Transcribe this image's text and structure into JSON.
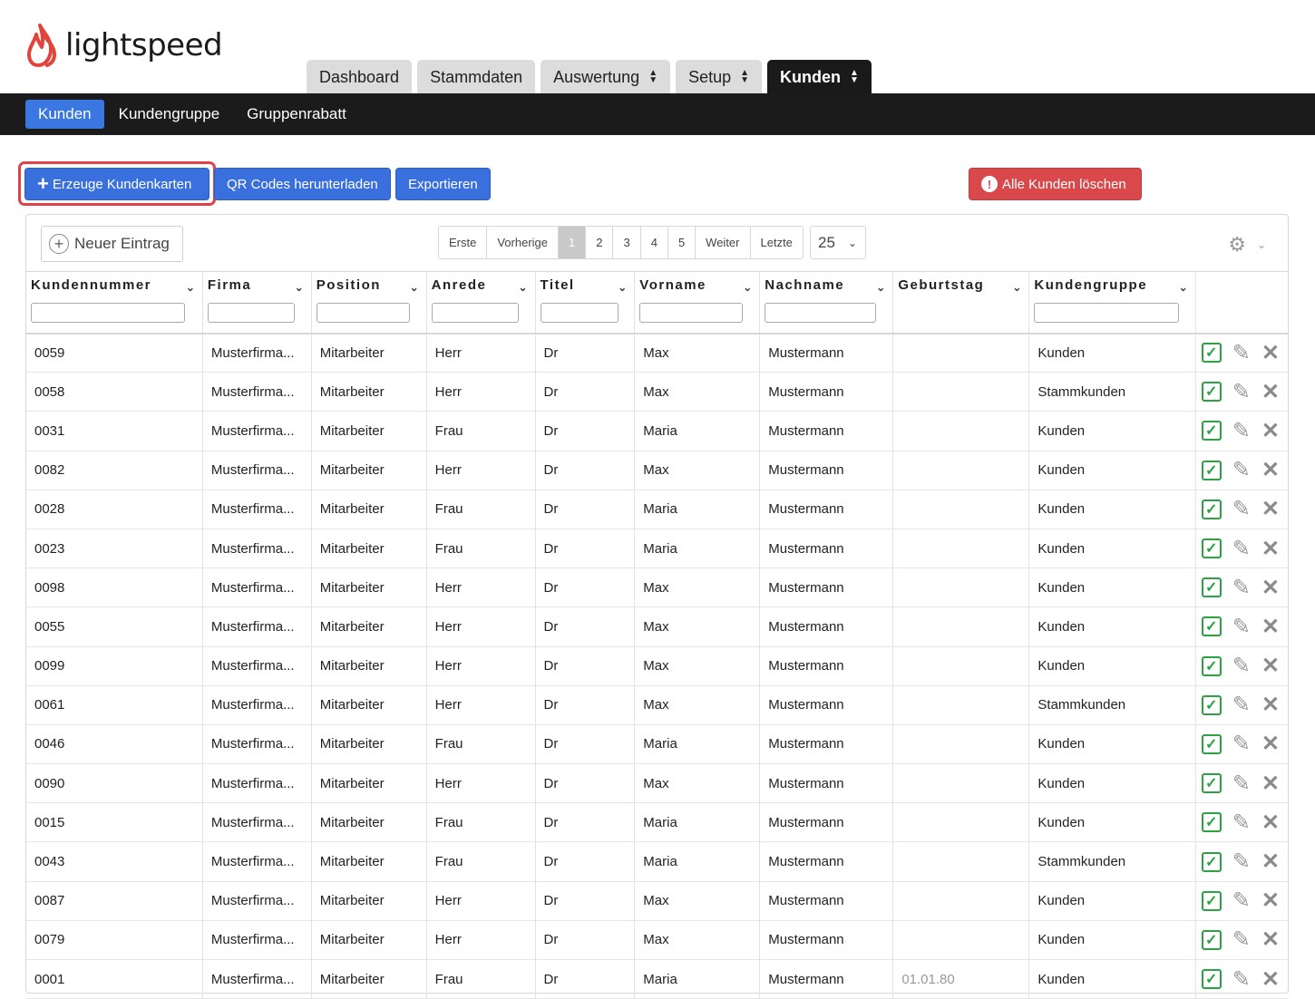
{
  "brand": {
    "name": "lightspeed",
    "color": "#e2433a"
  },
  "main_tabs": [
    {
      "label": "Dashboard",
      "sortable": false,
      "active": false
    },
    {
      "label": "Stammdaten",
      "sortable": false,
      "active": false
    },
    {
      "label": "Auswertung",
      "sortable": true,
      "active": false
    },
    {
      "label": "Setup",
      "sortable": true,
      "active": false
    },
    {
      "label": "Kunden",
      "sortable": true,
      "active": true
    }
  ],
  "subnav": [
    {
      "label": "Kunden",
      "active": true
    },
    {
      "label": "Kundengruppe",
      "active": false
    },
    {
      "label": "Gruppenrabatt",
      "active": false
    }
  ],
  "actions": {
    "create_cards": "Erzeuge Kundenkarten",
    "qr_codes": "QR Codes herunterladen",
    "export": "Exportieren",
    "delete_all": "Alle Kunden löschen"
  },
  "toolbar": {
    "new_entry": "Neuer Eintrag",
    "pager": [
      "Erste",
      "Vorherige",
      "1",
      "2",
      "3",
      "4",
      "5",
      "Weiter",
      "Letzte"
    ],
    "current_page": "1",
    "page_size": "25"
  },
  "columns": [
    "Kundennummer",
    "Firma",
    "Position",
    "Anrede",
    "Titel",
    "Vorname",
    "Nachname",
    "Geburtstag",
    "Kundengruppe"
  ],
  "rows": [
    [
      "0059",
      "Musterfirma...",
      "Mitarbeiter",
      "Herr",
      "Dr",
      "Max",
      "Mustermann",
      "",
      "Kunden"
    ],
    [
      "0058",
      "Musterfirma...",
      "Mitarbeiter",
      "Herr",
      "Dr",
      "Max",
      "Mustermann",
      "",
      "Stammkunden"
    ],
    [
      "0031",
      "Musterfirma...",
      "Mitarbeiter",
      "Frau",
      "Dr",
      "Maria",
      "Mustermann",
      "",
      "Kunden"
    ],
    [
      "0082",
      "Musterfirma...",
      "Mitarbeiter",
      "Herr",
      "Dr",
      "Max",
      "Mustermann",
      "",
      "Kunden"
    ],
    [
      "0028",
      "Musterfirma...",
      "Mitarbeiter",
      "Frau",
      "Dr",
      "Maria",
      "Mustermann",
      "",
      "Kunden"
    ],
    [
      "0023",
      "Musterfirma...",
      "Mitarbeiter",
      "Frau",
      "Dr",
      "Maria",
      "Mustermann",
      "",
      "Kunden"
    ],
    [
      "0098",
      "Musterfirma...",
      "Mitarbeiter",
      "Herr",
      "Dr",
      "Max",
      "Mustermann",
      "",
      "Kunden"
    ],
    [
      "0055",
      "Musterfirma...",
      "Mitarbeiter",
      "Herr",
      "Dr",
      "Max",
      "Mustermann",
      "",
      "Kunden"
    ],
    [
      "0099",
      "Musterfirma...",
      "Mitarbeiter",
      "Herr",
      "Dr",
      "Max",
      "Mustermann",
      "",
      "Kunden"
    ],
    [
      "0061",
      "Musterfirma...",
      "Mitarbeiter",
      "Herr",
      "Dr",
      "Max",
      "Mustermann",
      "",
      "Stammkunden"
    ],
    [
      "0046",
      "Musterfirma...",
      "Mitarbeiter",
      "Frau",
      "Dr",
      "Maria",
      "Mustermann",
      "",
      "Kunden"
    ],
    [
      "0090",
      "Musterfirma...",
      "Mitarbeiter",
      "Herr",
      "Dr",
      "Max",
      "Mustermann",
      "",
      "Kunden"
    ],
    [
      "0015",
      "Musterfirma...",
      "Mitarbeiter",
      "Frau",
      "Dr",
      "Maria",
      "Mustermann",
      "",
      "Kunden"
    ],
    [
      "0043",
      "Musterfirma...",
      "Mitarbeiter",
      "Frau",
      "Dr",
      "Maria",
      "Mustermann",
      "",
      "Stammkunden"
    ],
    [
      "0087",
      "Musterfirma...",
      "Mitarbeiter",
      "Herr",
      "Dr",
      "Max",
      "Mustermann",
      "",
      "Kunden"
    ],
    [
      "0079",
      "Musterfirma...",
      "Mitarbeiter",
      "Herr",
      "Dr",
      "Max",
      "Mustermann",
      "",
      "Kunden"
    ],
    [
      "0001",
      "Musterfirma...",
      "Mitarbeiter",
      "Frau",
      "Dr",
      "Maria",
      "Mustermann",
      "01.01.80",
      "Kunden"
    ]
  ],
  "row_actions": [
    "check-icon",
    "pencil-icon",
    "close-icon"
  ]
}
